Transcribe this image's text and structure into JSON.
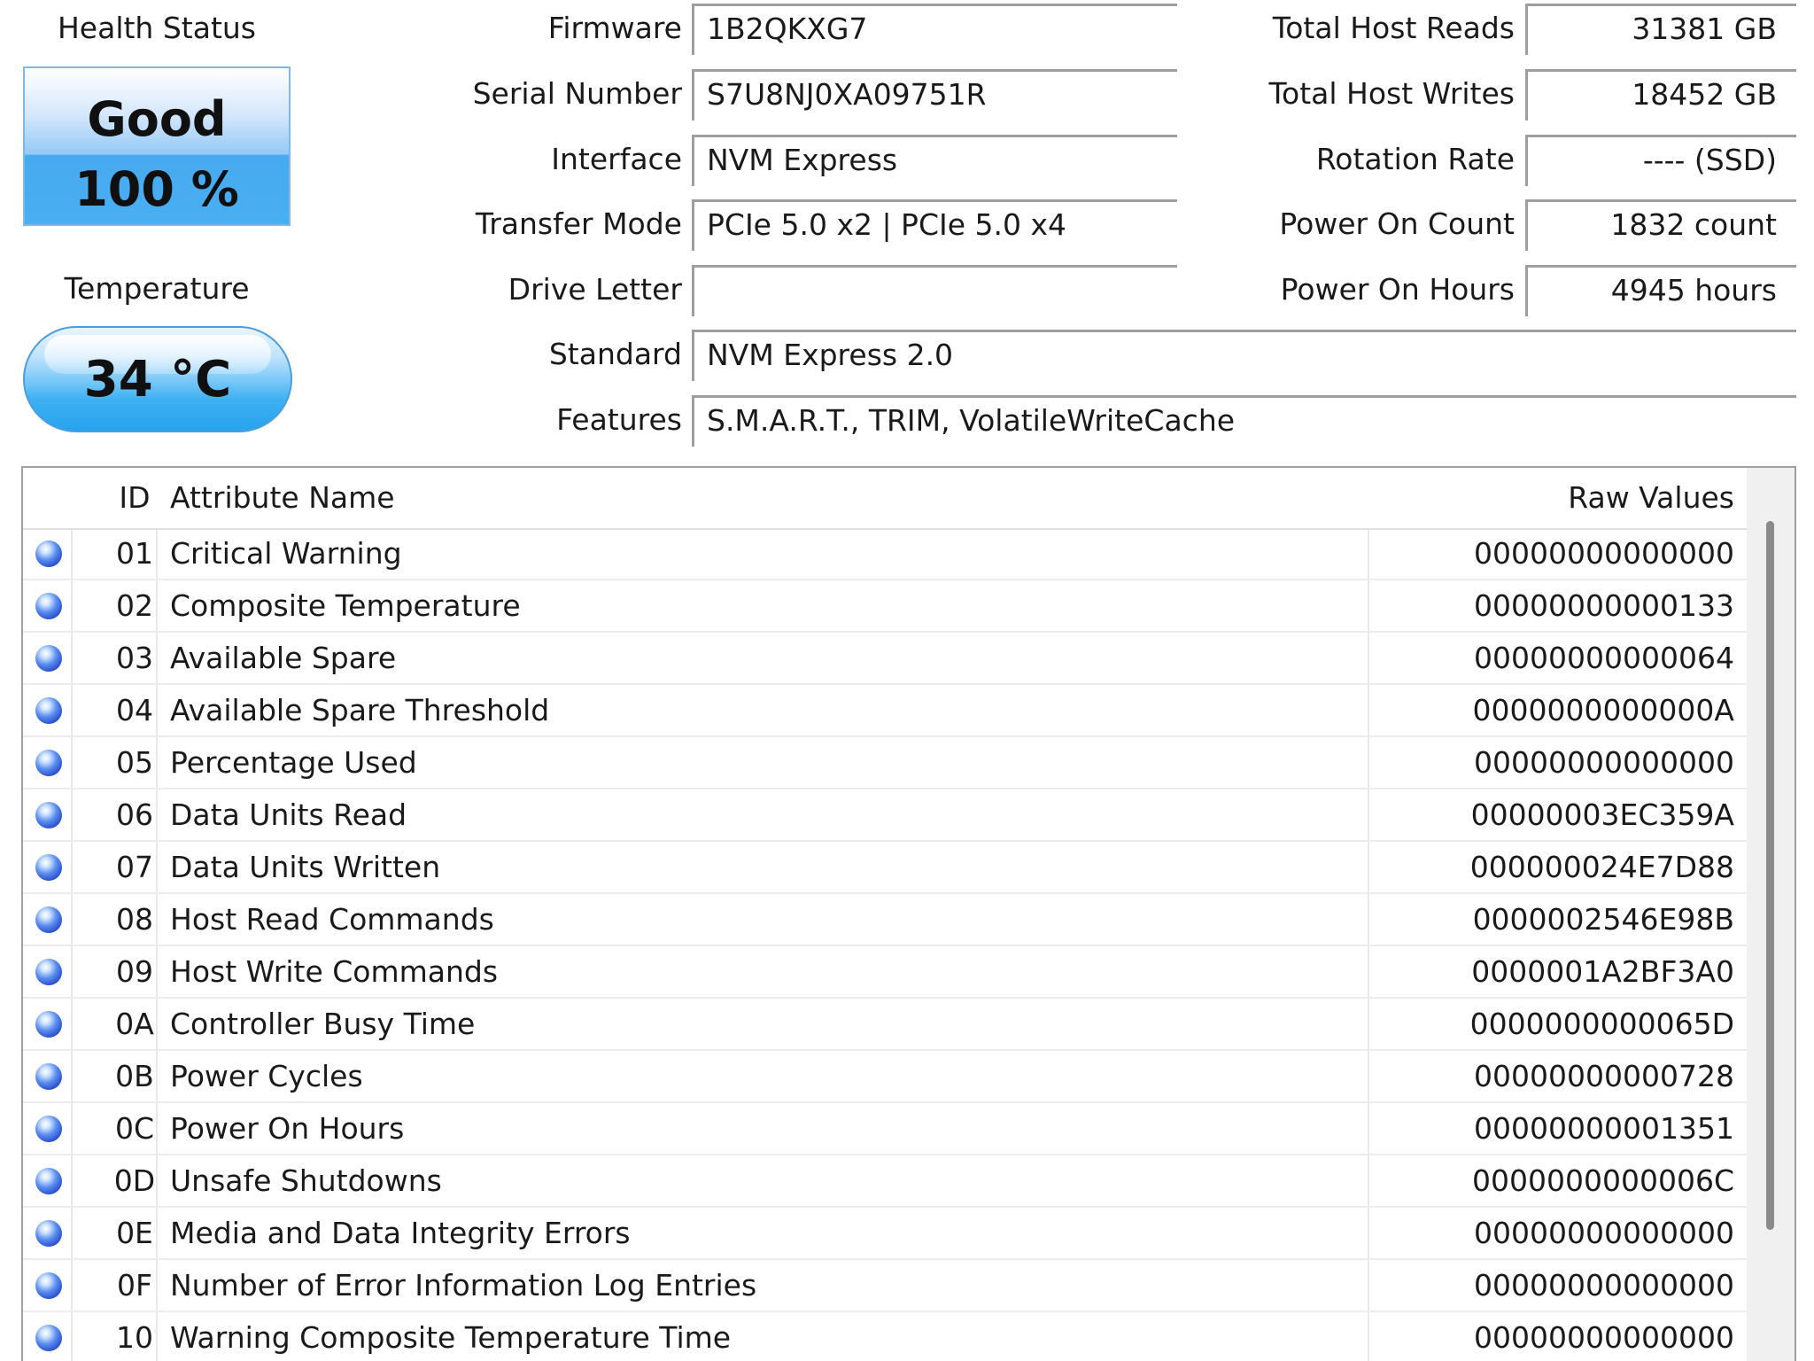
{
  "health": {
    "title": "Health Status",
    "status": "Good",
    "percent": "100 %"
  },
  "temperature": {
    "title": "Temperature",
    "value": "34 °C"
  },
  "info": {
    "firmware": {
      "label": "Firmware",
      "value": "1B2QKXG7"
    },
    "serial": {
      "label": "Serial Number",
      "value": "S7U8NJ0XA09751R"
    },
    "interface": {
      "label": "Interface",
      "value": "NVM Express"
    },
    "transfer": {
      "label": "Transfer Mode",
      "value": "PCIe 5.0 x2 | PCIe 5.0 x4"
    },
    "drive_letter": {
      "label": "Drive Letter",
      "value": ""
    },
    "standard": {
      "label": "Standard",
      "value": "NVM Express 2.0"
    },
    "features": {
      "label": "Features",
      "value": "S.M.A.R.T., TRIM, VolatileWriteCache"
    },
    "host_reads": {
      "label": "Total Host Reads",
      "value": "31381 GB"
    },
    "host_writes": {
      "label": "Total Host Writes",
      "value": "18452 GB"
    },
    "rotation": {
      "label": "Rotation Rate",
      "value": "---- (SSD)"
    },
    "power_count": {
      "label": "Power On Count",
      "value": "1832 count"
    },
    "power_hours": {
      "label": "Power On Hours",
      "value": "4945 hours"
    }
  },
  "table": {
    "headers": {
      "id": "ID",
      "name": "Attribute Name",
      "raw": "Raw Values"
    },
    "rows": [
      {
        "id": "01",
        "name": "Critical Warning",
        "raw": "00000000000000"
      },
      {
        "id": "02",
        "name": "Composite Temperature",
        "raw": "00000000000133"
      },
      {
        "id": "03",
        "name": "Available Spare",
        "raw": "00000000000064"
      },
      {
        "id": "04",
        "name": "Available Spare Threshold",
        "raw": "0000000000000A"
      },
      {
        "id": "05",
        "name": "Percentage Used",
        "raw": "00000000000000"
      },
      {
        "id": "06",
        "name": "Data Units Read",
        "raw": "00000003EC359A"
      },
      {
        "id": "07",
        "name": "Data Units Written",
        "raw": "000000024E7D88"
      },
      {
        "id": "08",
        "name": "Host Read Commands",
        "raw": "0000002546E98B"
      },
      {
        "id": "09",
        "name": "Host Write Commands",
        "raw": "0000001A2BF3A0"
      },
      {
        "id": "0A",
        "name": "Controller Busy Time",
        "raw": "0000000000065D"
      },
      {
        "id": "0B",
        "name": "Power Cycles",
        "raw": "00000000000728"
      },
      {
        "id": "0C",
        "name": "Power On Hours",
        "raw": "00000000001351"
      },
      {
        "id": "0D",
        "name": "Unsafe Shutdowns",
        "raw": "0000000000006C"
      },
      {
        "id": "0E",
        "name": "Media and Data Integrity Errors",
        "raw": "00000000000000"
      },
      {
        "id": "0F",
        "name": "Number of Error Information Log Entries",
        "raw": "00000000000000"
      },
      {
        "id": "10",
        "name": "Warning Composite Temperature Time",
        "raw": "00000000000000"
      }
    ]
  },
  "colors": {
    "status_good": "#4aaef2",
    "temperature_ok": "#27a3ef",
    "status_dot": "#2345c8"
  }
}
